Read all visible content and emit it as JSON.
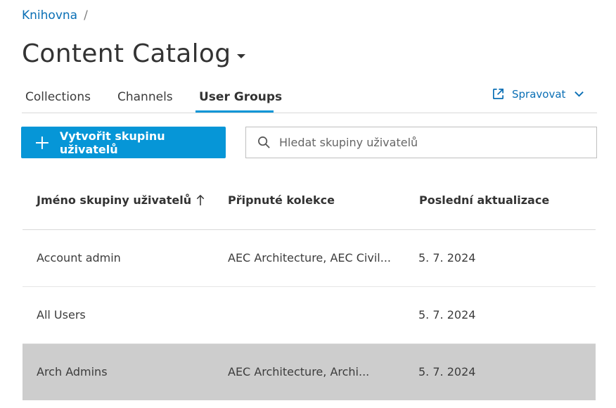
{
  "breadcrumb": {
    "root": "Knihovna",
    "separator": "/"
  },
  "page": {
    "title": "Content Catalog"
  },
  "tabs": [
    {
      "label": "Collections",
      "active": false
    },
    {
      "label": "Channels",
      "active": false
    },
    {
      "label": "User Groups",
      "active": true
    }
  ],
  "manage": {
    "label": "Spravovat"
  },
  "create_button": {
    "label": "Vytvořit skupinu uživatelů"
  },
  "search": {
    "placeholder": "Hledat skupiny uživatelů"
  },
  "table": {
    "columns": {
      "name": "Jméno skupiny uživatelů",
      "collections": "Připnuté kolekce",
      "updated": "Poslední aktualizace"
    },
    "rows": [
      {
        "name": "Account admin",
        "collections": "AEC Architecture, AEC Civil...",
        "updated": "5. 7. 2024"
      },
      {
        "name": "All Users",
        "collections": "",
        "updated": "5. 7. 2024"
      },
      {
        "name": "Arch Admins",
        "collections": "AEC Architecture, Archi...",
        "updated": "5. 7. 2024",
        "selected": true
      }
    ]
  },
  "colors": {
    "accent": "#0696d7",
    "link": "#0a6fb5",
    "selected_row": "#cdcdcd"
  }
}
